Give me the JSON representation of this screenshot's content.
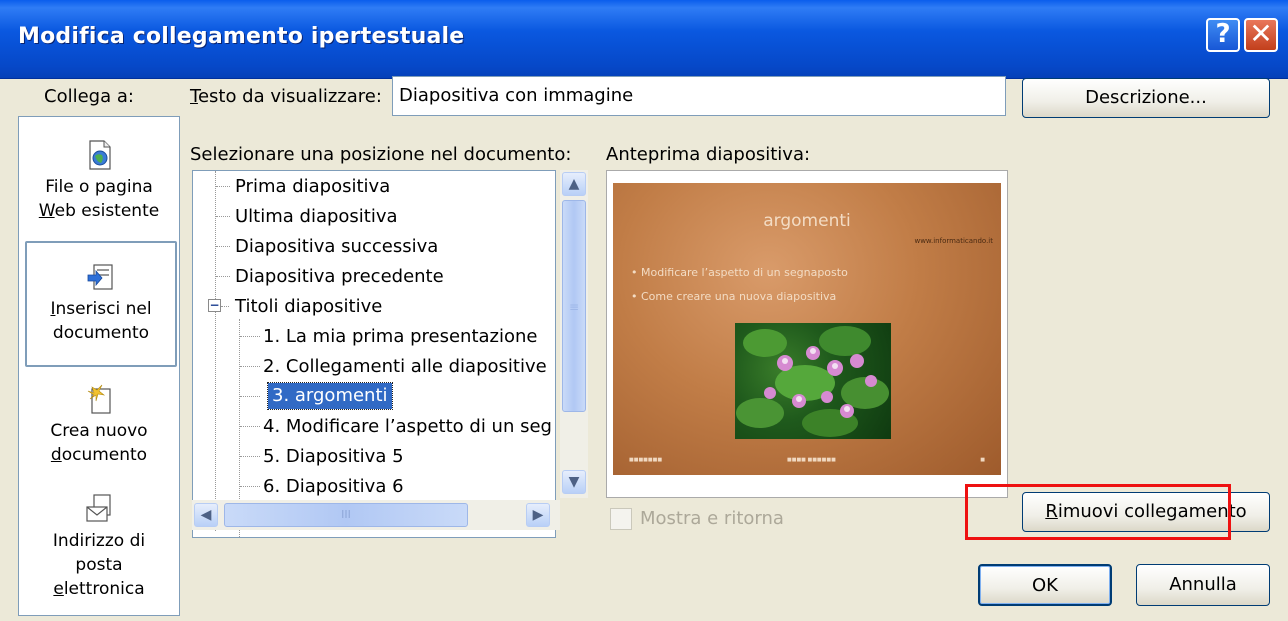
{
  "window": {
    "title": "Modifica collegamento ipertestuale",
    "help_label": "?",
    "close_label": "✕"
  },
  "link_to": {
    "label": "Collega a:",
    "items": [
      {
        "line1": "File o pagina",
        "line2_u": "W",
        "line2": "eb esistente",
        "icon": "web-page-icon",
        "selected": false
      },
      {
        "line1_u": "I",
        "line1": "nserisci nel",
        "line2": "documento",
        "icon": "place-in-document-icon",
        "selected": true
      },
      {
        "line1": "Crea nuovo",
        "line2_u": "d",
        "line2": "ocumento",
        "icon": "new-document-icon",
        "selected": false
      },
      {
        "line1": "Indirizzo di",
        "line2": "posta",
        "line3_u": "e",
        "line3": "lettronica",
        "icon": "email-address-icon",
        "selected": false
      }
    ]
  },
  "display_text": {
    "label_u": "T",
    "label": "esto da visualizzare:",
    "value": "Diapositiva con immagine"
  },
  "buttons": {
    "description": "Descrizione...",
    "remove_link": "Rimuovi collegamento",
    "ok": "OK",
    "cancel": "Annulla"
  },
  "position": {
    "label": "Selezionare una posizione nel documento:",
    "nodes": [
      "Prima diapositiva",
      "Ultima diapositiva",
      "Diapositiva successiva",
      "Diapositiva precedente",
      "Titoli diapositive",
      "1. La mia prima presentazione",
      "2. Collegamenti alle diapositive",
      "3. argomenti",
      "4. Modificare l’aspetto di un seg",
      "5. Diapositiva 5",
      "6. Diapositiva 6"
    ],
    "selected_index": 7,
    "expander": "−",
    "scroll_grip": "≡",
    "hscroll_grip": "III"
  },
  "preview": {
    "label": "Anteprima diapositiva:",
    "slide_title": "argomenti",
    "slide_url": "www.informaticando.it",
    "bullets": [
      "Modificare l’aspetto di un segnaposto",
      "Come creare una nuova diapositiva"
    ],
    "footer_left": "■■■■■■■",
    "footer_center": "■■■■ ■■■■■■",
    "footer_right": "■"
  },
  "show_and_return": {
    "label": "Mostra e ritorna",
    "checked": false
  },
  "colors": {
    "titlebar": "#0A58E0",
    "selection": "#316AC5",
    "highlight": "#EE1111"
  }
}
